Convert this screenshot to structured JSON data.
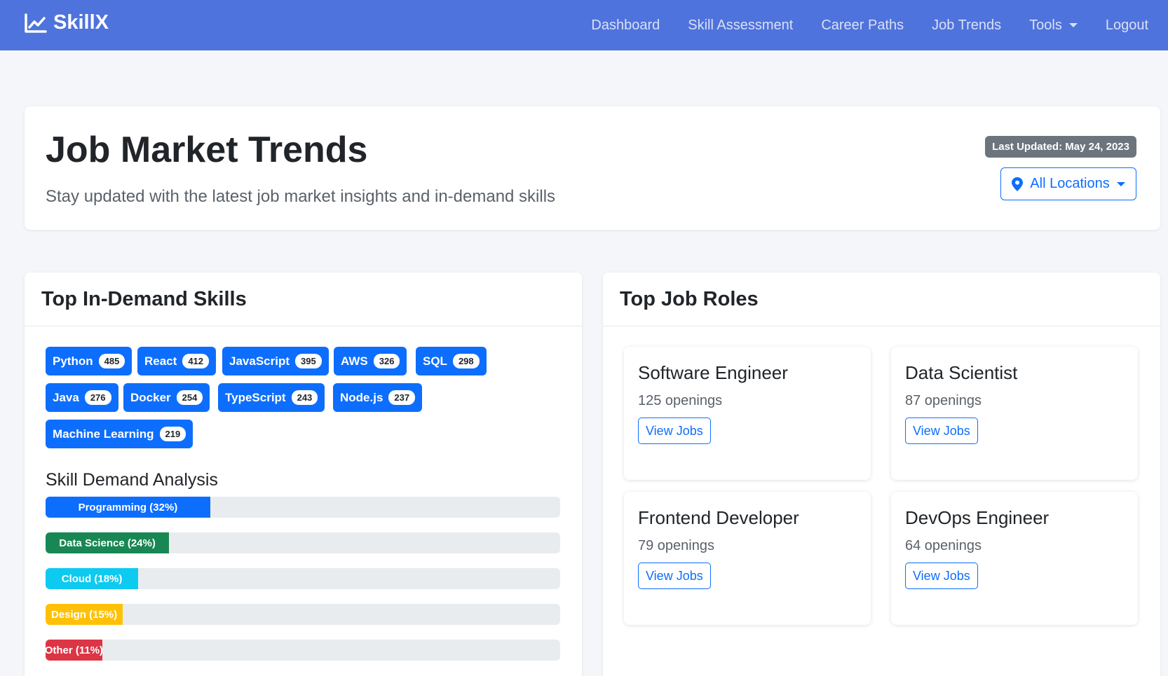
{
  "nav": {
    "brand": "SkillX",
    "links": [
      "Dashboard",
      "Skill Assessment",
      "Career Paths",
      "Job Trends",
      "Tools",
      "Logout"
    ]
  },
  "header": {
    "title": "Job Market Trends",
    "subtitle": "Stay updated with the latest job market insights and in-demand skills",
    "last_updated": "Last Updated: May 24, 2023",
    "location": "All Locations"
  },
  "skills": {
    "title": "Top In-Demand Skills",
    "tags": [
      {
        "name": "Python",
        "count": "485"
      },
      {
        "name": "React",
        "count": "412"
      },
      {
        "name": "JavaScript",
        "count": "395"
      },
      {
        "name": "AWS",
        "count": "326"
      },
      {
        "name": "SQL",
        "count": "298"
      },
      {
        "name": "Java",
        "count": "276"
      },
      {
        "name": "Docker",
        "count": "254"
      },
      {
        "name": "TypeScript",
        "count": "243"
      },
      {
        "name": "Node.js",
        "count": "237"
      },
      {
        "name": "Machine Learning",
        "count": "219"
      }
    ],
    "analysis_title": "Skill Demand Analysis",
    "bars": [
      {
        "label": "Programming (32%)",
        "percent": 32,
        "color": "#0d6efd"
      },
      {
        "label": "Data Science (24%)",
        "percent": 24,
        "color": "#198754"
      },
      {
        "label": "Cloud (18%)",
        "percent": 18,
        "color": "#0dcaf0"
      },
      {
        "label": "Design (15%)",
        "percent": 15,
        "color": "#ffc107"
      },
      {
        "label": "Other (11%)",
        "percent": 11,
        "color": "#dc3545"
      }
    ]
  },
  "roles": {
    "title": "Top Job Roles",
    "items": [
      {
        "title": "Software Engineer",
        "openings": "125 openings",
        "button": "View Jobs"
      },
      {
        "title": "Data Scientist",
        "openings": "87 openings",
        "button": "View Jobs"
      },
      {
        "title": "Frontend Developer",
        "openings": "79 openings",
        "button": "View Jobs"
      },
      {
        "title": "DevOps Engineer",
        "openings": "64 openings",
        "button": "View Jobs"
      }
    ]
  }
}
